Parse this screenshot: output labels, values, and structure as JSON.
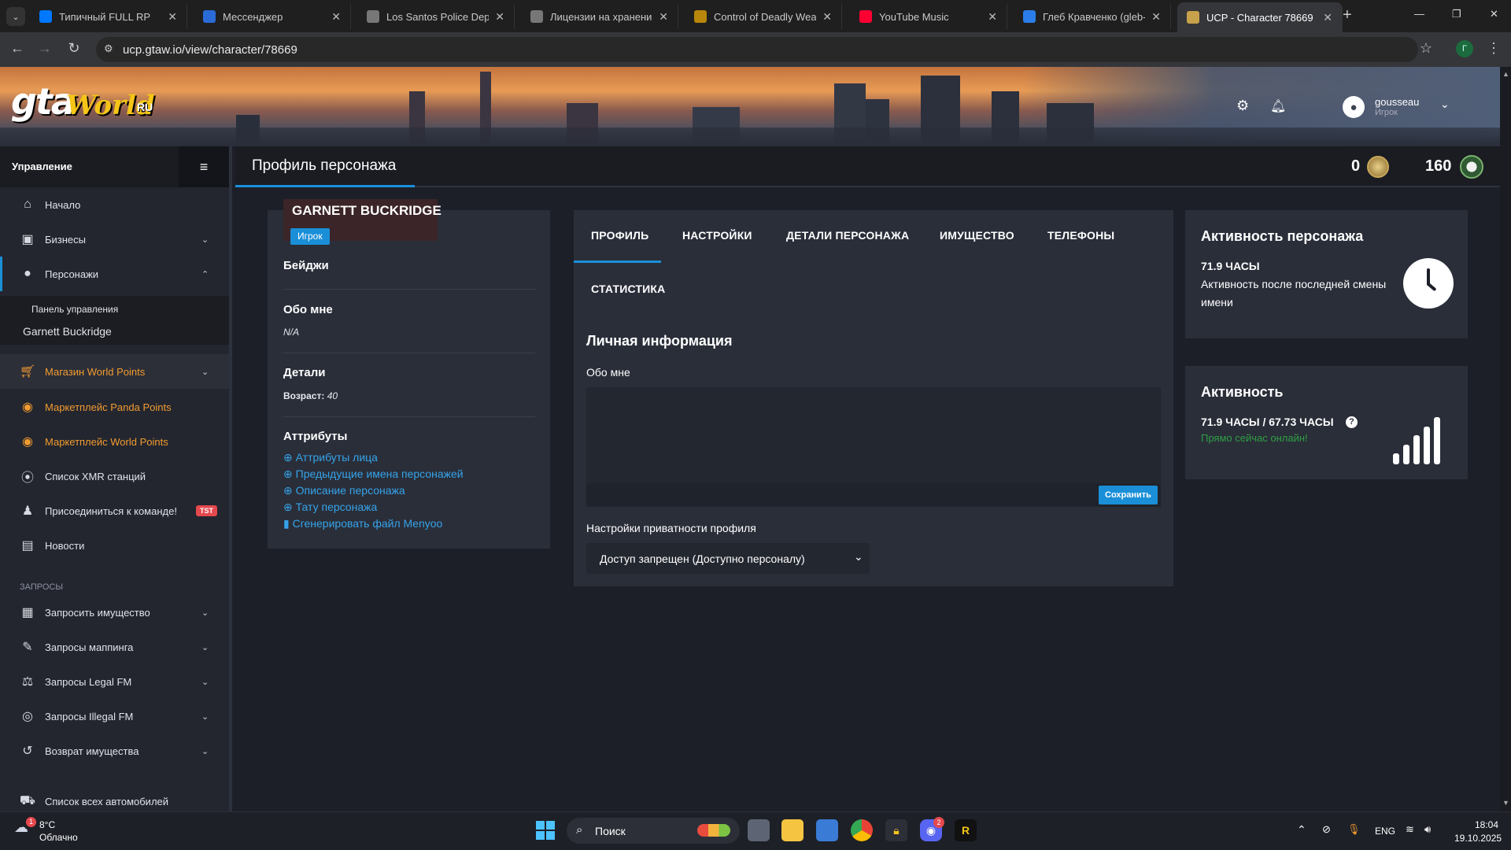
{
  "browser": {
    "tabs": [
      {
        "title": "Типичный FULL RP",
        "icon": "vk-icon",
        "color": "#0077ff"
      },
      {
        "title": "Мессенджер",
        "icon": "messenger-icon",
        "color": "#2a6bd8"
      },
      {
        "title": "Los Santos Police Departm",
        "icon": "globe-icon",
        "color": "#777777"
      },
      {
        "title": "Лицензии на хранение и",
        "icon": "globe-icon",
        "color": "#777777"
      },
      {
        "title": "Control of Deadly Weapo",
        "icon": "forum-icon",
        "color": "#b8860b"
      },
      {
        "title": "YouTube Music",
        "icon": "youtube-music-icon",
        "color": "#ff0033"
      },
      {
        "title": "Глеб Кравченко (gleb-kr",
        "icon": "lbb-icon",
        "color": "#2b7de9"
      },
      {
        "title": "UCP - Character 78669",
        "icon": "ucp-icon",
        "color": "#c8a24a"
      }
    ],
    "url": "ucp.gtaw.io/view/character/78669",
    "profile_initial": "Г"
  },
  "header": {
    "logo_text": "gta World",
    "logo_suffix": "RU",
    "username": "gousseau",
    "user_role": "Игрок"
  },
  "sidebar": {
    "heading": "Управление",
    "items": [
      {
        "label": "Начало",
        "icon": "home-icon"
      },
      {
        "label": "Бизнесы",
        "icon": "briefcase-icon"
      },
      {
        "label": "Персонажи",
        "icon": "person-icon"
      },
      {
        "label": "Панель управления"
      },
      {
        "label": "Garnett Buckridge"
      },
      {
        "label": "Магазин World Points",
        "icon": "cart-icon"
      },
      {
        "label": "Маркетплейс Panda Points",
        "icon": "coins-icon"
      },
      {
        "label": "Маркетплейс World Points",
        "icon": "coins-icon"
      },
      {
        "label": "Список XMR станций",
        "icon": "antenna-icon"
      },
      {
        "label": "Присоединиться к команде!",
        "icon": "person-tie-icon",
        "badge": "TST"
      },
      {
        "label": "Новости",
        "icon": "newspaper-icon"
      },
      {
        "label": "Запросить имущество",
        "icon": "building-icon"
      },
      {
        "label": "Запросы маппинга",
        "icon": "brush-icon"
      },
      {
        "label": "Запросы Legal FM",
        "icon": "scales-icon"
      },
      {
        "label": "Запросы Illegal FM",
        "icon": "mask-icon"
      },
      {
        "label": "Возврат имущества",
        "icon": "undo-icon"
      },
      {
        "label": "Список всех автомобилей",
        "icon": "car-icon"
      }
    ],
    "section_label": "ЗАПРОСЫ"
  },
  "page": {
    "title": "Профиль персонажа",
    "wp_count": "0",
    "pp_count": "160"
  },
  "character": {
    "name": "GARNETT BUCKRIDGE",
    "role_badge": "Игрок",
    "badges_title": "Бейджи",
    "about_title": "Обо мне",
    "about_value": "N/A",
    "details_title": "Детали",
    "age_label": "Возраст:",
    "age_value": "40",
    "attributes_title": "Аттрибуты",
    "links": [
      "Аттрибуты лица",
      "Предыдущие имена персонажей",
      "Описание персонажа",
      "Тату персонажа",
      "Сгенерировать файл Menyoo"
    ]
  },
  "profile_tabs": [
    "ПРОФИЛЬ",
    "НАСТРОЙКИ",
    "ДЕТАЛИ ПЕРСОНАЖА",
    "ИМУЩЕСТВО",
    "ТЕЛЕФОНЫ",
    "СТАТИСТИКА"
  ],
  "personal": {
    "title": "Личная информация",
    "about_label": "Обо мне",
    "about_value": "",
    "save_label": "Сохранить",
    "privacy_label": "Настройки приватности профиля",
    "privacy_value": "Доступ запрещен (Доступно персоналу)"
  },
  "activity_char": {
    "title": "Активность персонажа",
    "hours": "71.9 ЧАСЫ",
    "desc": "Активность после последней смены имени"
  },
  "activity": {
    "title": "Активность",
    "hours": "71.9 ЧАСЫ / 67.73 ЧАСЫ",
    "status": "Прямо сейчас онлайн!"
  },
  "taskbar": {
    "weather_temp": "8°C",
    "weather_desc": "Облачно",
    "weather_badge": "1",
    "search_label": "Поиск",
    "discord_badge": "2",
    "lang": "ENG",
    "time": "18:04",
    "date": "19.10.2025"
  },
  "colors": {
    "accent": "#1a8fd8",
    "orange": "#f29b30",
    "online": "#2ea043",
    "link": "#35a4ea"
  }
}
